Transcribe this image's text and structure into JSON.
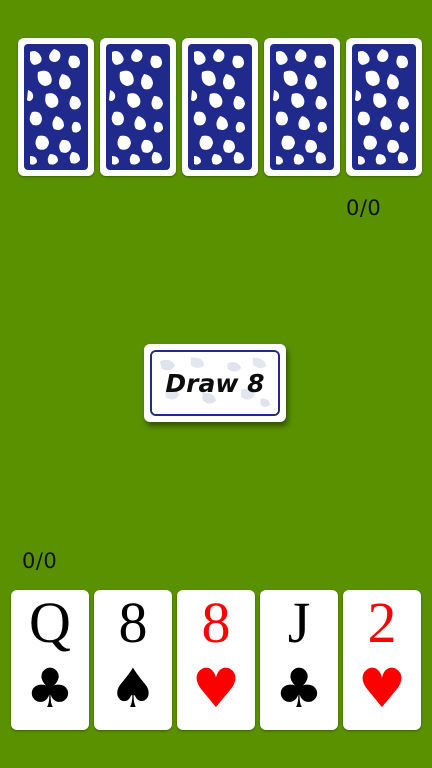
{
  "opponent": {
    "score": "0/0",
    "cards": [
      {
        "face": "back"
      },
      {
        "face": "back"
      },
      {
        "face": "back"
      },
      {
        "face": "back"
      },
      {
        "face": "back"
      }
    ]
  },
  "center": {
    "draw_button_label": "Draw 8"
  },
  "player": {
    "score": "0/0",
    "hand": [
      {
        "rank": "Q",
        "suit": "♣",
        "suit_name": "clubs",
        "color": "#000000"
      },
      {
        "rank": "8",
        "suit": "♠",
        "suit_name": "spades",
        "color": "#000000"
      },
      {
        "rank": "8",
        "suit": "♥",
        "suit_name": "hearts",
        "color": "#ff0000"
      },
      {
        "rank": "J",
        "suit": "♣",
        "suit_name": "clubs",
        "color": "#000000"
      },
      {
        "rank": "2",
        "suit": "♥",
        "suit_name": "hearts",
        "color": "#ff0000"
      }
    ]
  },
  "colors": {
    "table": "#5a9100",
    "card_back": "#1f2a8c",
    "card_face": "#ffffff"
  }
}
